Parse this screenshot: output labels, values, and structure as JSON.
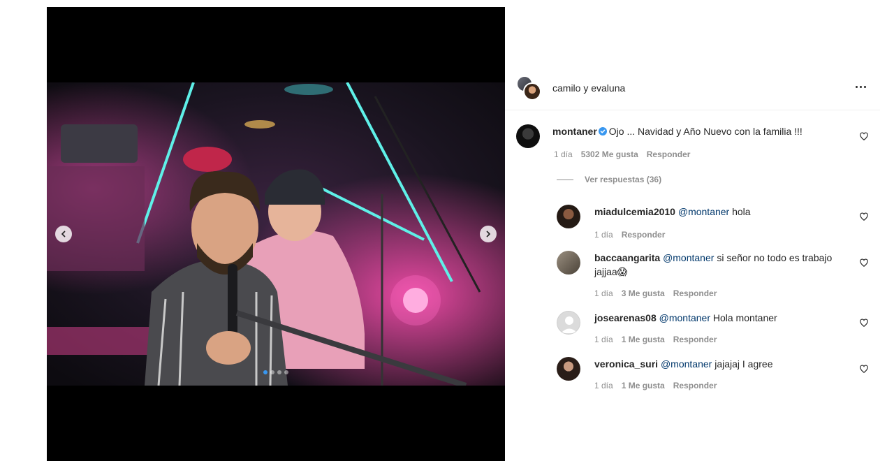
{
  "post": {
    "author": "camilo y evaluna",
    "carousel": {
      "total_slides": 4,
      "active_slide": 1
    }
  },
  "main_comment": {
    "username": "montaner",
    "verified": true,
    "text": "Ojo ... Navidad y Año Nuevo con la familia !!!",
    "time": "1 día",
    "likes": "5302 Me gusta",
    "reply_label": "Responder",
    "view_replies": "Ver respuestas (36)"
  },
  "replies": [
    {
      "username": "miadulcemia2010",
      "mention": "@montaner",
      "text": "hola",
      "time": "1 día",
      "likes": "",
      "reply_label": "Responder"
    },
    {
      "username": "baccaangarita",
      "mention": "@montaner",
      "text": "si señor no todo es trabajo jajjaa😱",
      "time": "1 día",
      "likes": "3 Me gusta",
      "reply_label": "Responder"
    },
    {
      "username": "josearenas08",
      "mention": "@montaner",
      "text": "Hola montaner",
      "time": "1 día",
      "likes": "1 Me gusta",
      "reply_label": "Responder"
    },
    {
      "username": "veronica_suri",
      "mention": "@montaner",
      "text": "jajajaj I agree",
      "time": "1 día",
      "likes": "1 Me gusta",
      "reply_label": "Responder"
    }
  ],
  "icons": {
    "more": "more-options-icon",
    "like": "heart-icon",
    "verified": "verified-badge-icon",
    "prev": "chevron-left-icon",
    "next": "chevron-right-icon"
  },
  "colors": {
    "text": "#262626",
    "secondary": "#8e8e8e",
    "mention": "#00376b",
    "verified": "#3897f0"
  }
}
